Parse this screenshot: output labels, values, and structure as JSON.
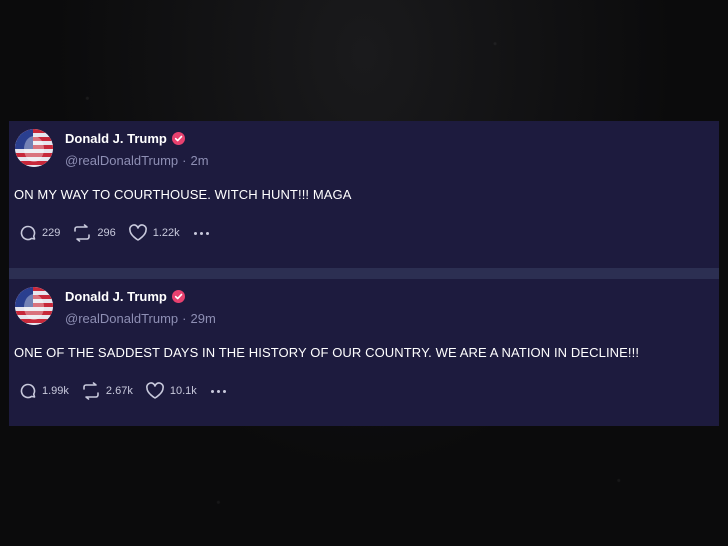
{
  "posts": [
    {
      "author": "Donald J. Trump",
      "handle": "@realDonaldTrump",
      "separator": "·",
      "time": "2m",
      "text": "ON MY WAY TO COURTHOUSE. WITCH HUNT!!! MAGA",
      "replies": "229",
      "reposts": "296",
      "likes": "1.22k"
    },
    {
      "author": "Donald J. Trump",
      "handle": "@realDonaldTrump",
      "separator": "·",
      "time": "29m",
      "text": "ONE OF THE SADDEST DAYS IN THE HISTORY OF OUR COUNTRY. WE ARE A NATION IN DECLINE!!!",
      "replies": "1.99k",
      "reposts": "2.67k",
      "likes": "10.1k"
    }
  ],
  "colors": {
    "card_background": "#1d1b3e",
    "divider": "#2c2f52",
    "verified_badge": "#e8416f",
    "handle_text": "#8e8fb4"
  },
  "icons": [
    "avatar-flag",
    "verified-badge-icon",
    "reply-icon",
    "repost-icon",
    "like-icon",
    "more-icon"
  ]
}
